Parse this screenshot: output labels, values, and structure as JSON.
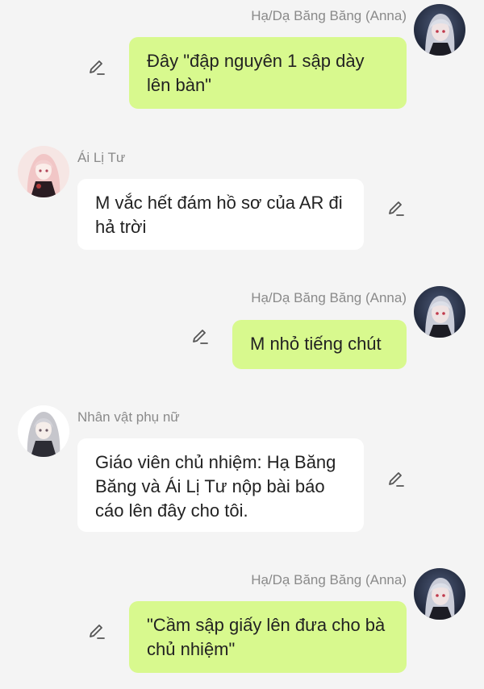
{
  "messages": [
    {
      "direction": "out",
      "sender": "Hạ/Dạ Băng Băng (Anna)",
      "text": "Đây \"đập nguyên 1 sập dày lên bàn\"",
      "avatar_icon": "anna-avatar"
    },
    {
      "direction": "in",
      "sender": "Ái Lị Tư",
      "text": "M vắc hết đám hồ sơ của AR đi hả trời",
      "avatar_icon": "ai-li-tu-avatar"
    },
    {
      "direction": "out",
      "sender": "Hạ/Dạ Băng Băng (Anna)",
      "text": "M nhỏ tiếng chút",
      "avatar_icon": "anna-avatar"
    },
    {
      "direction": "in",
      "sender": "Nhân vật phụ nữ",
      "text": "Giáo viên chủ nhiệm: Hạ Băng Băng và Ái Lị Tư nộp bài báo cáo lên đây cho tôi.",
      "avatar_icon": "female-character-avatar"
    },
    {
      "direction": "out",
      "sender": "Hạ/Dạ Băng Băng (Anna)",
      "text": "\"Cầm sập giấy lên đưa cho bà chủ nhiệm\"",
      "avatar_icon": "anna-avatar"
    }
  ],
  "colors": {
    "background": "#f4f4f4",
    "outgoing_bubble": "#d8f98e",
    "incoming_bubble": "#ffffff",
    "name_text": "#8a8a8a",
    "icon": "#555555"
  },
  "icons": {
    "edit": "pencil-edit-icon"
  }
}
